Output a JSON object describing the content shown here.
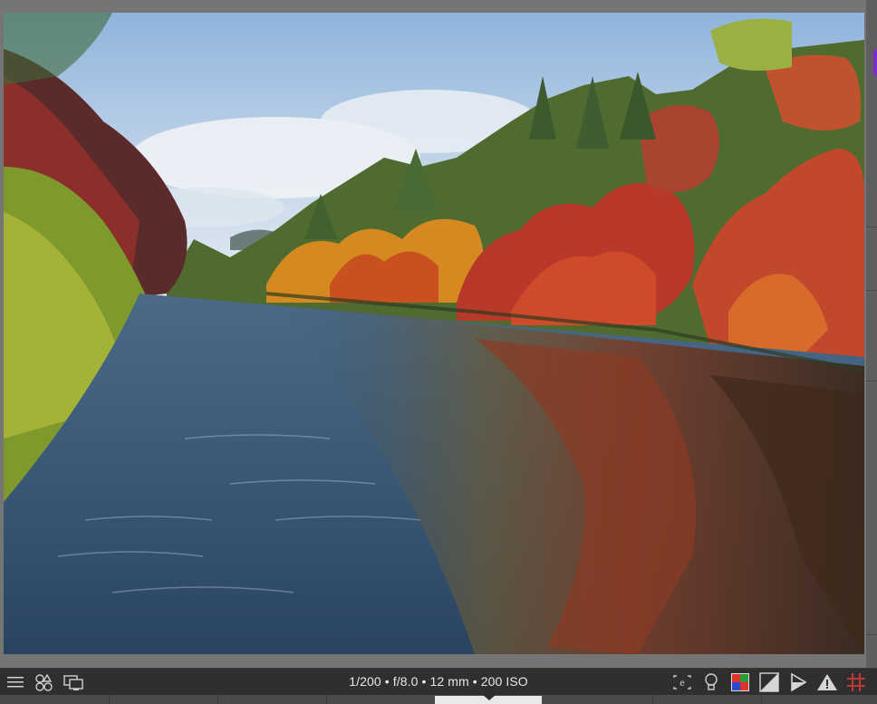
{
  "photo": {
    "alt": "Autumn foliage reflected in a calm river"
  },
  "toolbar": {
    "exif": {
      "shutter": "1/200",
      "aperture": "f/8.0",
      "focal_length": "12 mm",
      "iso": "200 ISO",
      "separator": "•",
      "line": "1/200 • f/8.0 • 12 mm • 200 ISO"
    },
    "left_icons": [
      "hamburger-menu-icon",
      "filters-icon",
      "display-icon"
    ],
    "right_icons": [
      "focus-peaking-icon",
      "lightbulb-icon",
      "color-assessment-icon",
      "exposure-split-icon",
      "raw-overexposed-icon",
      "clipping-warning-icon",
      "guide-overlay-icon"
    ]
  },
  "colors": {
    "canvas": "#757575",
    "toolbar": "#2f2f2f",
    "accent": "#7b2bd0",
    "warning_icon": "#e53b3b",
    "grid_overlay": "#e23a3a"
  }
}
